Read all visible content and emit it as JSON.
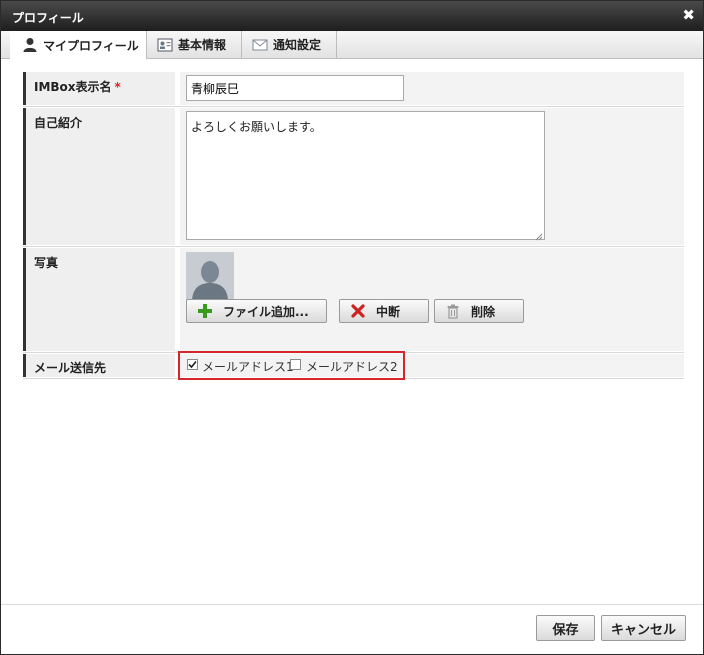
{
  "dialog": {
    "title": "プロフィール",
    "close_glyph": "✖"
  },
  "tabs": [
    {
      "label": "マイプロフィール",
      "icon": "person-icon"
    },
    {
      "label": "基本情報",
      "icon": "id-card-icon"
    },
    {
      "label": "通知設定",
      "icon": "envelope-icon"
    }
  ],
  "form": {
    "display_name": {
      "label": "IMBox表示名",
      "required_mark": "*",
      "value": "青柳辰巳"
    },
    "bio": {
      "label": "自己紹介",
      "value": "よろしくお願いします。"
    },
    "photo": {
      "label": "写真",
      "add_button": "ファイル追加...",
      "cancel_button": "中断",
      "delete_button": "削除"
    },
    "mail": {
      "label": "メール送信先",
      "options": [
        {
          "label": "メールアドレス1",
          "checked": true
        },
        {
          "label": "メールアドレス2",
          "checked": false
        }
      ]
    }
  },
  "footer": {
    "save": "保存",
    "cancel": "キャンセル"
  },
  "colors": {
    "titlebar": "#1e1e1e",
    "highlight_border": "#d4262b",
    "add_icon": "#3a9a1e",
    "cancel_icon": "#cc2222"
  }
}
